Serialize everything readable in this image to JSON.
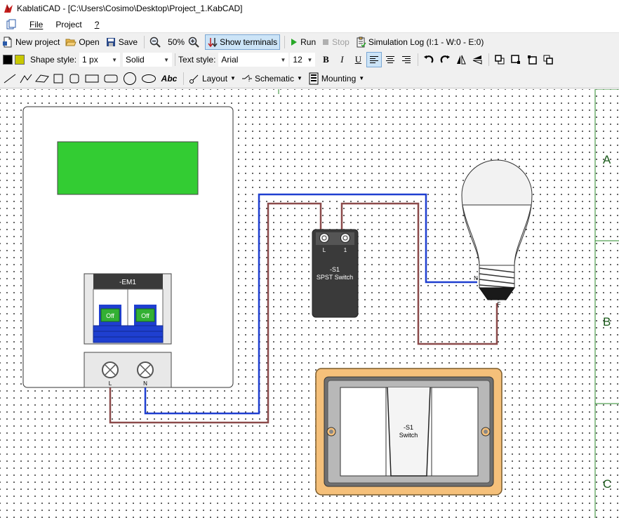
{
  "window": {
    "title": "KablatiCAD - [C:\\Users\\Cosimo\\Desktop\\Project_1.KabCAD]"
  },
  "menu": {
    "file": "File",
    "project": "Project",
    "help": "?"
  },
  "toolbar1": {
    "new_project": "New project",
    "open": "Open",
    "save": "Save",
    "zoom": "50%",
    "show_terminals": "Show terminals",
    "run": "Run",
    "stop": "Stop",
    "simulation_log": "Simulation Log (I:1 - W:0 - E:0)"
  },
  "toolbar2": {
    "shape_style_label": "Shape style:",
    "line_width": "1 px",
    "line_type": "Solid",
    "text_style_label": "Text style:",
    "font": "Arial",
    "font_size": "12",
    "bold": "B",
    "italic": "I",
    "underline": "U"
  },
  "toolbar3": {
    "text_tool": "Abc",
    "layout": "Layout",
    "schematic": "Schematic",
    "mounting": "Mounting"
  },
  "drawing": {
    "breaker_label": "-EM1",
    "breaker_pole_1": "Off",
    "breaker_pole_2": "Off",
    "terminal_l": "L",
    "terminal_n": "N",
    "switch_ref": "-S1",
    "switch_desc": "SPST Switch",
    "switch_term_l": "L",
    "switch_term_1": "1",
    "lamp_term_n": "N",
    "lamp_term_f": "F",
    "plate_ref": "-S1",
    "plate_desc": "Switch",
    "row_a": "A",
    "row_b": "B",
    "row_c": "C"
  },
  "colors": {
    "wire_neutral": "#1f3fd0",
    "wire_live": "#8b4a4a",
    "display_green": "#33cc33",
    "switch_body": "#3a3a3a",
    "plate_frame": "#f5c07a"
  }
}
